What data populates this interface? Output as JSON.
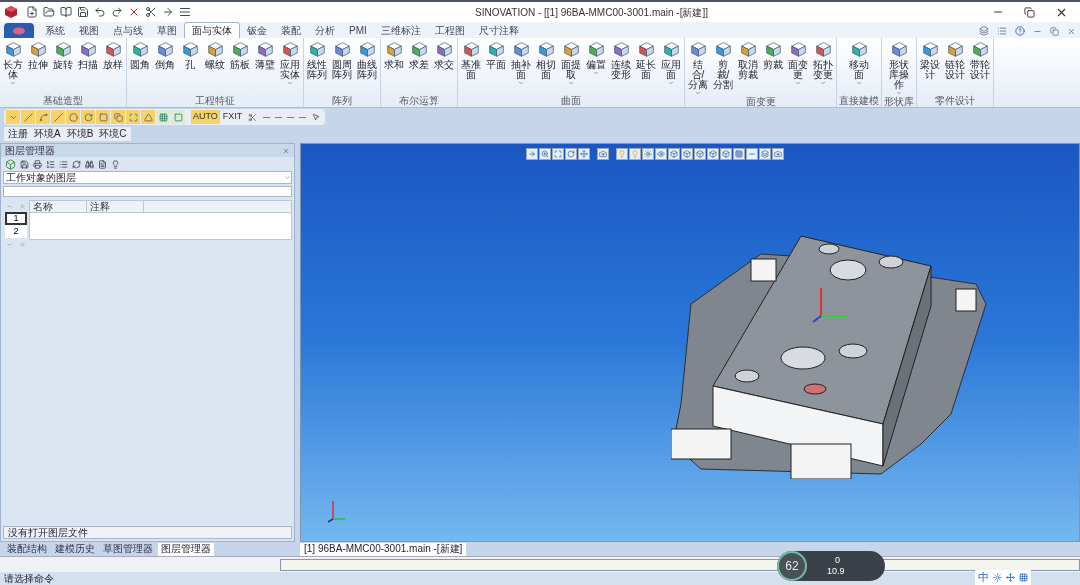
{
  "title_bar": {
    "title": "SINOVATION - [[1] 96BA-MMC00-3001.main -[新建]]"
  },
  "ribbon_tabs": [
    {
      "label": "系统",
      "selected": false
    },
    {
      "label": "视图",
      "selected": false
    },
    {
      "label": "点与线",
      "selected": false
    },
    {
      "label": "草图",
      "selected": false
    },
    {
      "label": "面与实体",
      "selected": true
    },
    {
      "label": "钣金",
      "selected": false
    },
    {
      "label": "装配",
      "selected": false
    },
    {
      "label": "分析",
      "selected": false
    },
    {
      "label": "PMI",
      "selected": false
    },
    {
      "label": "三维标注",
      "selected": false
    },
    {
      "label": "工程图",
      "selected": false
    },
    {
      "label": "尺寸注释",
      "selected": false
    }
  ],
  "ribbon_groups": [
    {
      "title": "基础造型",
      "buttons": [
        {
          "label": "长方体",
          "has_menu": true
        },
        {
          "label": "拉伸",
          "has_menu": false
        },
        {
          "label": "旋转",
          "has_menu": false
        },
        {
          "label": "扫描",
          "has_menu": false
        },
        {
          "label": "放样",
          "has_menu": false
        }
      ]
    },
    {
      "title": "工程特征",
      "buttons": [
        {
          "label": "圆角",
          "has_menu": false
        },
        {
          "label": "倒角",
          "has_menu": false
        },
        {
          "label": "孔",
          "has_menu": false
        },
        {
          "label": "螺纹",
          "has_menu": false
        },
        {
          "label": "筋板",
          "has_menu": false
        },
        {
          "label": "薄壁",
          "has_menu": false
        },
        {
          "label": "应用实体",
          "has_menu": true
        }
      ]
    },
    {
      "title": "阵列",
      "buttons": [
        {
          "label": "线性阵列",
          "has_menu": false
        },
        {
          "label": "圆周阵列",
          "has_menu": false
        },
        {
          "label": "曲线阵列",
          "has_menu": false
        }
      ]
    },
    {
      "title": "布尔运算",
      "buttons": [
        {
          "label": "求和",
          "has_menu": false
        },
        {
          "label": "求差",
          "has_menu": false
        },
        {
          "label": "求交",
          "has_menu": false
        }
      ]
    },
    {
      "title": "曲面",
      "buttons": [
        {
          "label": "基准面",
          "has_menu": false
        },
        {
          "label": "平面",
          "has_menu": false
        },
        {
          "label": "抽补面",
          "has_menu": true
        },
        {
          "label": "相切面",
          "has_menu": false
        },
        {
          "label": "面提取",
          "has_menu": true
        },
        {
          "label": "偏置",
          "has_menu": true
        },
        {
          "label": "连续变形",
          "has_menu": false
        },
        {
          "label": "延长面",
          "has_menu": false
        },
        {
          "label": "应用面",
          "has_menu": true
        }
      ]
    },
    {
      "title": "面变更",
      "buttons": [
        {
          "label": "结合/分离",
          "has_menu": true
        },
        {
          "label": "剪裁/分割",
          "has_menu": false
        },
        {
          "label": "取消剪裁",
          "has_menu": false
        },
        {
          "label": "剪裁",
          "has_menu": false
        },
        {
          "label": "面变更",
          "has_menu": true
        },
        {
          "label": "拓扑变更",
          "has_menu": true
        }
      ]
    },
    {
      "title": "直接建模",
      "buttons": [
        {
          "label": "移动面",
          "has_menu": true
        }
      ]
    },
    {
      "title": "形状库",
      "buttons": [
        {
          "label": "形状库操作",
          "has_menu": true
        }
      ]
    },
    {
      "title": "零件设计",
      "buttons": [
        {
          "label": "梁设计",
          "has_menu": false
        },
        {
          "label": "链轮设计",
          "has_menu": false
        },
        {
          "label": "带轮设计",
          "has_menu": false
        }
      ]
    }
  ],
  "sketch_toolbar": {
    "modes": [
      {
        "label": "AUTO",
        "selected": true
      },
      {
        "label": "FXIT",
        "selected": false
      }
    ]
  },
  "environment_tabs": [
    {
      "label": "注册"
    },
    {
      "label": "环境A"
    },
    {
      "label": "环境B"
    },
    {
      "label": "环境C"
    }
  ],
  "layer_panel": {
    "title": "图层管理器",
    "filter": {
      "value": "工作对象的图层"
    },
    "columns": [
      "名称",
      "注释"
    ],
    "rows": [
      {
        "number": "1",
        "selected": true
      },
      {
        "number": "2",
        "selected": false
      }
    ],
    "status": "没有打开图层文件"
  },
  "panel_tabs": [
    {
      "label": "装配结构",
      "selected": false
    },
    {
      "label": "建模历史",
      "selected": false
    },
    {
      "label": "草图管理器",
      "selected": false
    },
    {
      "label": "图层管理器",
      "selected": true
    }
  ],
  "document_tab": {
    "label": "[1] 96BA-MMC00-3001.main -[新建]"
  },
  "status_bar": {
    "message": "请选择命令"
  },
  "network_widget": {
    "percent": "62",
    "upload": "0",
    "download": "10.9"
  },
  "ime_toolbar": {
    "mode": "中"
  }
}
